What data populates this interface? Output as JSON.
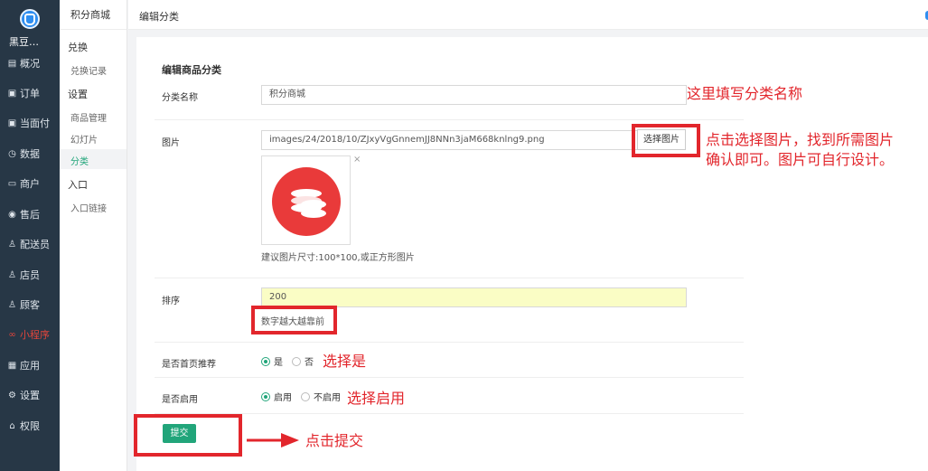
{
  "rail": {
    "shop_name": "黑豆…",
    "items": [
      {
        "label": "概况",
        "icon": "dashboard-icon"
      },
      {
        "label": "订单",
        "icon": "order-icon"
      },
      {
        "label": "当面付",
        "icon": "pay-icon"
      },
      {
        "label": "数据",
        "icon": "data-icon"
      },
      {
        "label": "商户",
        "icon": "merchant-icon"
      },
      {
        "label": "售后",
        "icon": "aftersale-icon"
      },
      {
        "label": "配送员",
        "icon": "courier-icon"
      },
      {
        "label": "店员",
        "icon": "clerk-icon"
      },
      {
        "label": "顾客",
        "icon": "customer-icon"
      },
      {
        "label": "小程序",
        "icon": "miniprogram-icon"
      },
      {
        "label": "应用",
        "icon": "apps-icon"
      },
      {
        "label": "设置",
        "icon": "settings-icon"
      },
      {
        "label": "权限",
        "icon": "permission-icon"
      }
    ]
  },
  "submenu": {
    "title": "积分商城",
    "groups": [
      {
        "label": "兑换",
        "links": [
          "兑换记录"
        ]
      },
      {
        "label": "设置",
        "links": [
          "商品管理",
          "幻灯片",
          "分类"
        ]
      },
      {
        "label": "入口",
        "links": [
          "入口链接"
        ]
      }
    ],
    "active": "分类"
  },
  "topbar": {
    "title": "编辑分类"
  },
  "form": {
    "heading": "编辑商品分类",
    "name_label": "分类名称",
    "name_value": "积分商城",
    "image_label": "图片",
    "image_value": "images/24/2018/10/ZJxyVgGnnemJJ8NNn3jaM668knlng9.png",
    "pick_button": "选择图片",
    "close_symbol": "×",
    "image_hint": "建议图片尺寸:100*100,或正方形图片",
    "order_label": "排序",
    "order_value": "200",
    "order_hint": "数字越大越靠前",
    "home_label": "是否首页推荐",
    "home_yes": "是",
    "home_no": "否",
    "enable_label": "是否启用",
    "enable_yes": "启用",
    "enable_no": "不启用",
    "submit": "提交"
  },
  "annotations": {
    "name_note": "这里填写分类名称",
    "image_note_1": "点击选择图片，找到所需图片",
    "image_note_2": "确认即可。图片可自行设计。",
    "home_note": "选择是",
    "enable_note": "选择启用",
    "submit_note": "点击提交"
  },
  "colors": {
    "accent": "#21a57a",
    "annotation": "#e2262c",
    "rail": "#273746"
  }
}
